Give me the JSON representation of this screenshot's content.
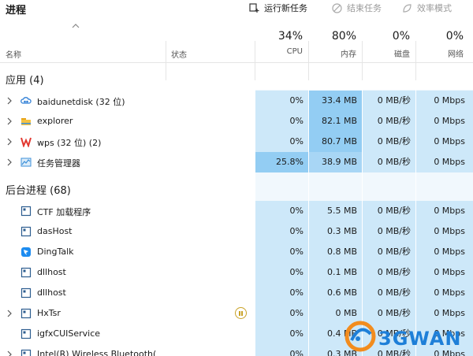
{
  "toolbar": {
    "title": "进程",
    "run_task": "运行新任务",
    "end_task": "结束任务",
    "efficiency_mode": "效率模式"
  },
  "columns": {
    "name": "名称",
    "status": "状态",
    "cpu": {
      "pct": "34%",
      "label": "CPU"
    },
    "memory": {
      "pct": "80%",
      "label": "内存"
    },
    "disk": {
      "pct": "0%",
      "label": "磁盘"
    },
    "network": {
      "pct": "0%",
      "label": "网络"
    }
  },
  "sections": {
    "apps": "应用 (4)",
    "background": "后台进程 (68)"
  },
  "apps": [
    {
      "name": "baidunetdisk (32 位)",
      "icon": "cloud-icon",
      "cpu": "0%",
      "mem": "33.4 MB",
      "disk": "0 MB/秒",
      "net": "0 Mbps"
    },
    {
      "name": "explorer",
      "icon": "folder-icon",
      "cpu": "0%",
      "mem": "82.1 MB",
      "disk": "0 MB/秒",
      "net": "0 Mbps"
    },
    {
      "name": "wps (32 位) (2)",
      "icon": "wps-icon",
      "cpu": "0%",
      "mem": "80.7 MB",
      "disk": "0 MB/秒",
      "net": "0 Mbps"
    },
    {
      "name": "任务管理器",
      "icon": "task-manager-icon",
      "cpu": "25.8%",
      "mem": "38.9 MB",
      "disk": "0 MB/秒",
      "net": "0 Mbps"
    }
  ],
  "background": [
    {
      "name": "CTF 加载程序",
      "cpu": "0%",
      "mem": "5.5 MB",
      "disk": "0 MB/秒",
      "net": "0 Mbps"
    },
    {
      "name": "dasHost",
      "cpu": "0%",
      "mem": "0.3 MB",
      "disk": "0 MB/秒",
      "net": "0 Mbps"
    },
    {
      "name": "DingTalk",
      "cpu": "0%",
      "mem": "0.8 MB",
      "disk": "0 MB/秒",
      "net": "0 Mbps"
    },
    {
      "name": "dllhost",
      "cpu": "0%",
      "mem": "0.1 MB",
      "disk": "0 MB/秒",
      "net": "0 Mbps"
    },
    {
      "name": "dllhost",
      "cpu": "0%",
      "mem": "0.6 MB",
      "disk": "0 MB/秒",
      "net": "0 Mbps"
    },
    {
      "name": "HxTsr",
      "cpu": "0%",
      "mem": "0 MB",
      "disk": "0 MB/秒",
      "net": "0 Mbps"
    },
    {
      "name": "igfxCUIService",
      "cpu": "0%",
      "mem": "0.4 MB",
      "disk": "0 MB/秒",
      "net": "0 Mbps"
    },
    {
      "name": "Intel(R) Wireless Bluetooth(",
      "cpu": "0%",
      "mem": "0.3 MB",
      "disk": "0 MB/秒",
      "net": "0 Mbps"
    }
  ],
  "watermark": "3GWAN"
}
